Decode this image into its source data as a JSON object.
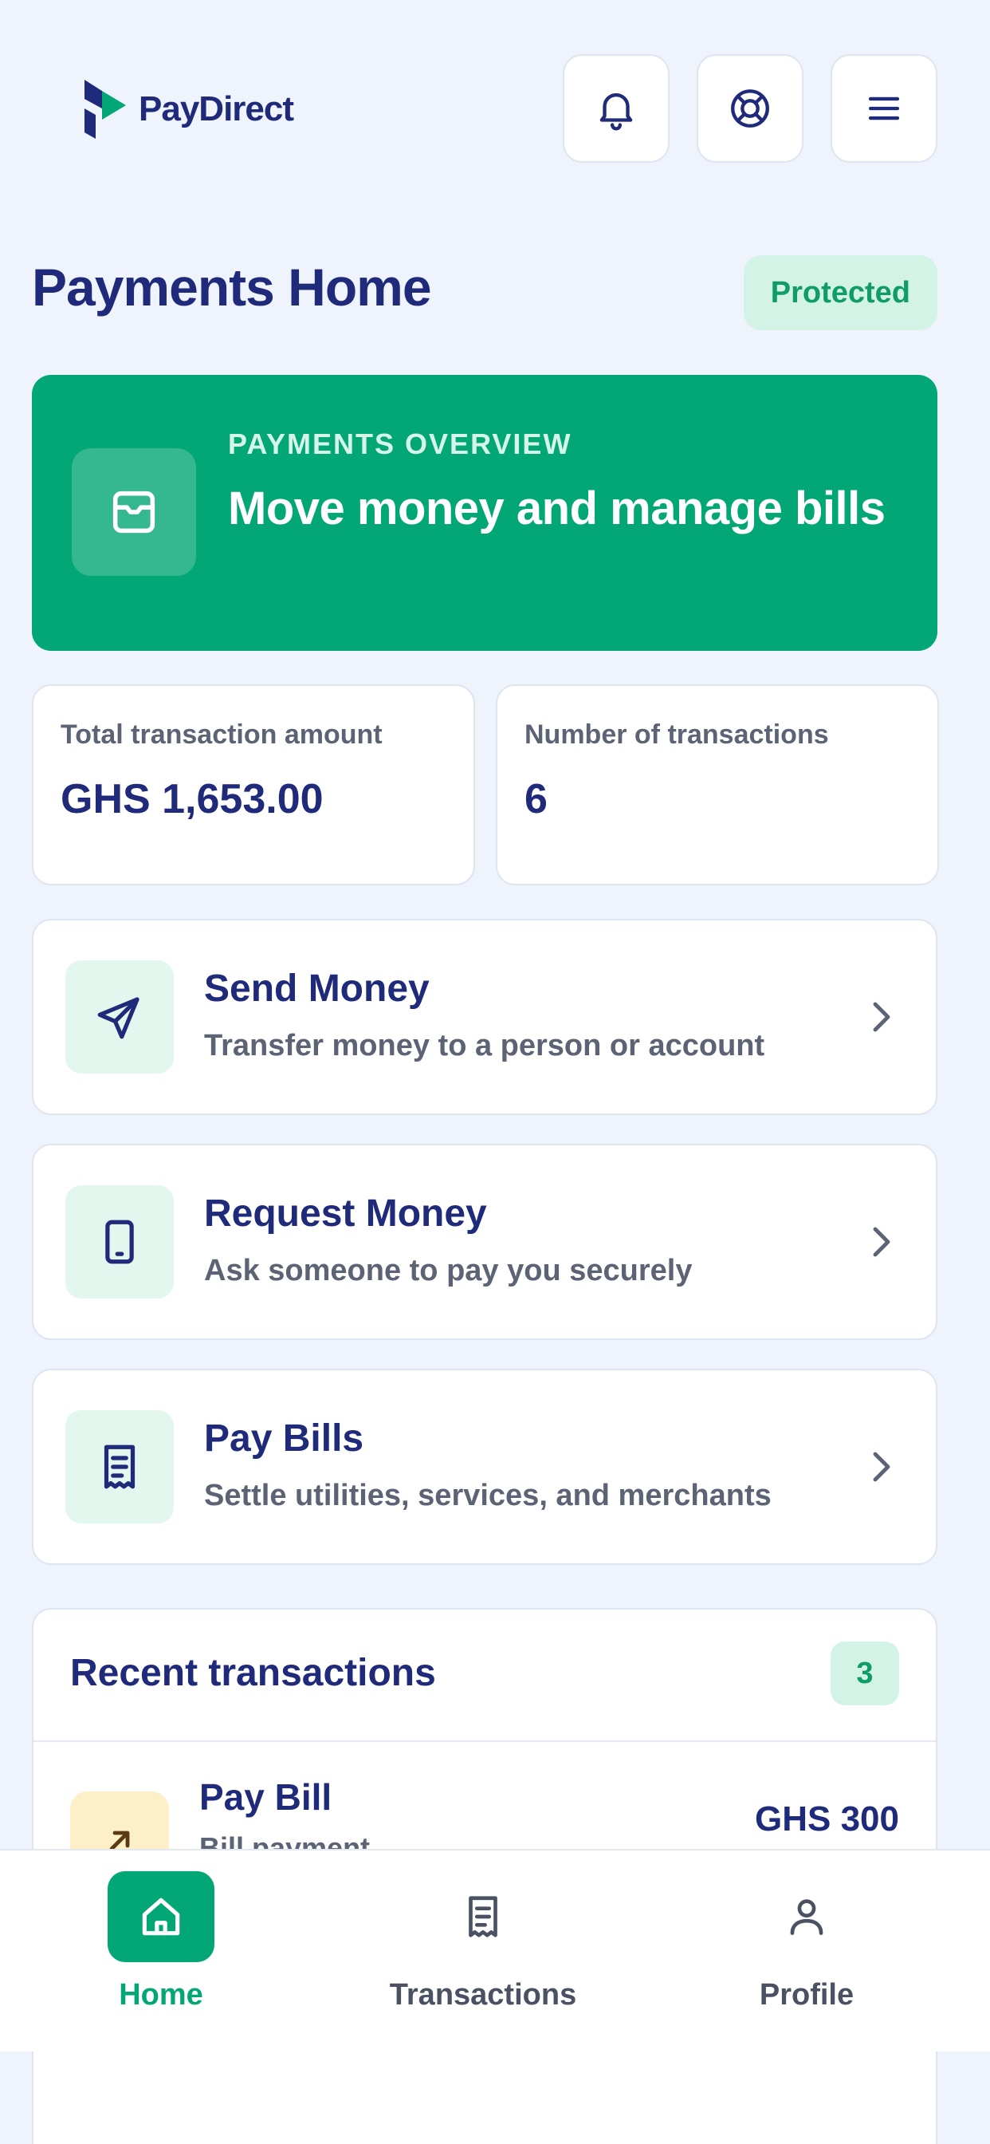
{
  "header": {
    "brand": "PayDirect",
    "icons": [
      "bell-icon",
      "lifebuoy-icon",
      "menu-icon"
    ]
  },
  "page": {
    "title": "Payments Home",
    "status_badge": "Protected"
  },
  "overview": {
    "kicker": "PAYMENTS OVERVIEW",
    "title": "Move money and manage bills",
    "icon": "wallet-icon"
  },
  "stats": [
    {
      "label": "Total transaction amount",
      "value": "GHS 1,653.00"
    },
    {
      "label": "Number of transactions",
      "value": "6"
    }
  ],
  "actions": [
    {
      "title": "Send Money",
      "subtitle": "Transfer money to a person or account",
      "icon": "send-icon"
    },
    {
      "title": "Request Money",
      "subtitle": "Ask someone to pay you securely",
      "icon": "phone-icon"
    },
    {
      "title": "Pay Bills",
      "subtitle": "Settle utilities, services, and merchants",
      "icon": "receipt-icon"
    }
  ],
  "recent": {
    "title": "Recent transactions",
    "count": "3",
    "items": [
      {
        "title": "Pay Bill",
        "subtitle": "Bill payment",
        "amount": "GHS 300",
        "icon": "arrow-up-right-icon"
      }
    ]
  },
  "nav": {
    "items": [
      {
        "label": "Home",
        "icon": "home-icon",
        "active": true
      },
      {
        "label": "Transactions",
        "icon": "receipt-icon",
        "active": false
      },
      {
        "label": "Profile",
        "icon": "user-icon",
        "active": false
      }
    ]
  },
  "colors": {
    "brand_green": "#03a675",
    "navy": "#1f2a7a",
    "background": "#eef3fc",
    "badge_bg": "#d3f3e6"
  }
}
